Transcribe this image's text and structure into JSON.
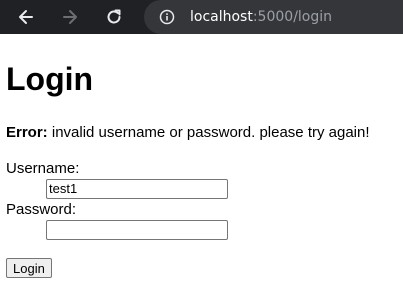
{
  "browser": {
    "url_host": "localhost",
    "url_rest": ":5000/login"
  },
  "page": {
    "title": "Login",
    "error_label": "Error:",
    "error_message": " invalid username or password. please try again!"
  },
  "form": {
    "username_label": "Username:",
    "username_value": "test1",
    "password_label": "Password:",
    "password_value": "",
    "submit_label": "Login"
  },
  "colors": {
    "toolbar_bg": "#202124",
    "address_bg": "#35363a"
  },
  "icons": [
    "back-arrow-icon",
    "forward-arrow-icon",
    "reload-icon",
    "info-icon"
  ]
}
